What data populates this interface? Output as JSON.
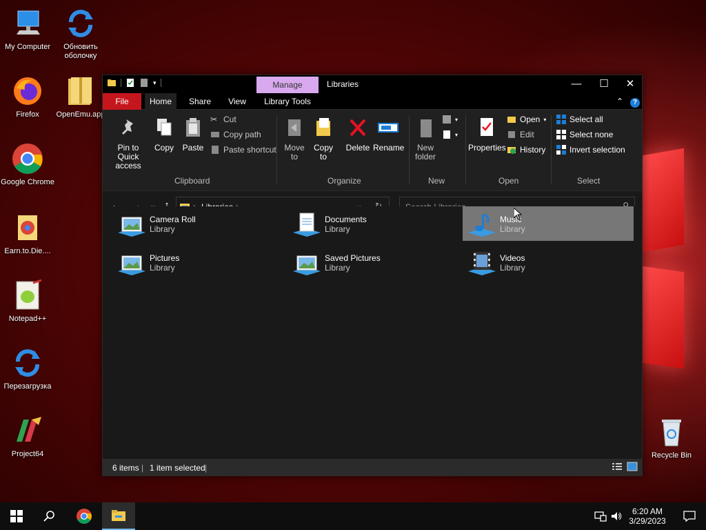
{
  "desktop": {
    "icons": [
      {
        "label": "My Computer"
      },
      {
        "label": "Обновить оболочку"
      },
      {
        "label": "Firefox"
      },
      {
        "label": "OpenEmu.app"
      },
      {
        "label": "Google Chrome"
      },
      {
        "label": "Earn.to.Die...."
      },
      {
        "label": "Notepad++"
      },
      {
        "label": "Перезагрузка"
      },
      {
        "label": "Project64"
      },
      {
        "label": "Recycle Bin"
      }
    ]
  },
  "window": {
    "title": "Libraries",
    "context_tab": "Manage",
    "tabs": [
      "File",
      "Home",
      "Share",
      "View",
      "Library Tools"
    ],
    "ribbon": {
      "clipboard": {
        "pin_label": "Pin to Quick access",
        "copy_label": "Copy",
        "paste_label": "Paste",
        "cut_label": "Cut",
        "copy_path_label": "Copy path",
        "paste_shortcut_label": "Paste shortcut",
        "group_label": "Clipboard"
      },
      "organize": {
        "move_to_label": "Move to",
        "copy_to_label": "Copy to",
        "delete_label": "Delete",
        "rename_label": "Rename",
        "group_label": "Organize"
      },
      "new": {
        "new_folder_label": "New folder",
        "group_label": "New"
      },
      "open": {
        "properties_label": "Properties",
        "open_label": "Open",
        "edit_label": "Edit",
        "history_label": "History",
        "group_label": "Open"
      },
      "select": {
        "select_all_label": "Select all",
        "select_none_label": "Select none",
        "invert_label": "Invert selection",
        "group_label": "Select"
      }
    },
    "address": {
      "path": "Libraries",
      "search_placeholder": "Search Libraries"
    },
    "items": [
      {
        "name": "Camera Roll",
        "type": "Library"
      },
      {
        "name": "Documents",
        "type": "Library"
      },
      {
        "name": "Music",
        "type": "Library"
      },
      {
        "name": "Pictures",
        "type": "Library"
      },
      {
        "name": "Saved Pictures",
        "type": "Library"
      },
      {
        "name": "Videos",
        "type": "Library"
      }
    ],
    "status": {
      "count": "6 items",
      "selection": "1 item selected"
    }
  },
  "taskbar": {
    "time": "6:20 AM",
    "date": "3/29/2023"
  },
  "colors": {
    "file_tab": "#c5161d",
    "manage_tab": "#d9a9ef",
    "selection": "#777777",
    "taskbar_active": "#76b9ed"
  }
}
